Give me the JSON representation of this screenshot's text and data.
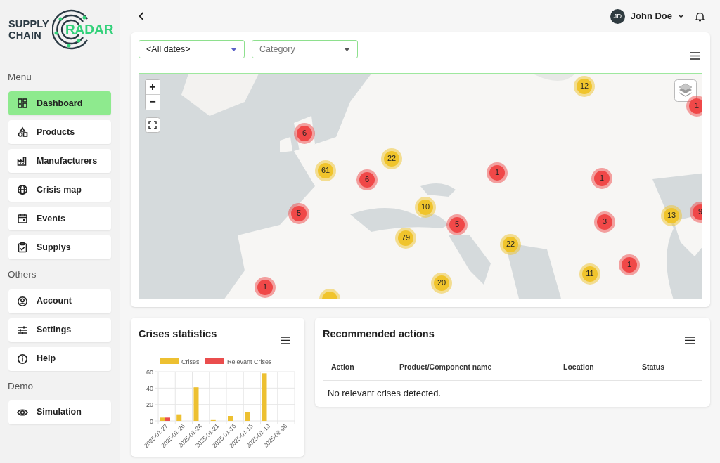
{
  "logo": {
    "line_1": "SUPPLY",
    "line_2": "CHAIN",
    "line_3": "RADAR"
  },
  "sidebar": {
    "sections": [
      {
        "title": "Menu",
        "items": [
          {
            "label": "Dashboard",
            "kind": "grid",
            "selected": true
          },
          {
            "label": "Products",
            "kind": "shapes",
            "selected": false
          },
          {
            "label": "Manufacturers",
            "kind": "factory",
            "selected": false
          },
          {
            "label": "Crisis map",
            "kind": "globe",
            "selected": false
          },
          {
            "label": "Events",
            "kind": "calendar",
            "selected": false
          },
          {
            "label": "Supplys",
            "kind": "clipboard",
            "selected": false
          }
        ]
      },
      {
        "title": "Others",
        "items": [
          {
            "label": "Account",
            "kind": "person",
            "selected": false
          },
          {
            "label": "Settings",
            "kind": "sliders",
            "selected": false
          },
          {
            "label": "Help",
            "kind": "info",
            "selected": false
          }
        ]
      },
      {
        "title": "Demo",
        "items": [
          {
            "label": "Simulation",
            "kind": "eye",
            "selected": false
          }
        ]
      }
    ]
  },
  "user": {
    "initials": "JD",
    "name": "John Doe"
  },
  "filters": [
    {
      "value": "<All dates>"
    },
    {
      "placeholder": "Category"
    }
  ],
  "map": {
    "zoom_in": "+",
    "zoom_out": "−",
    "clusters": [
      {
        "count": "12",
        "color": "#f0c42c"
      },
      {
        "count": "1",
        "color": "#f04848"
      },
      {
        "count": "6",
        "color": "#f04848"
      },
      {
        "count": "22",
        "color": "#f0c42c"
      },
      {
        "count": "61",
        "color": "#f0c42c"
      },
      {
        "count": "6",
        "color": "#f04848"
      },
      {
        "count": "1",
        "color": "#f04848"
      },
      {
        "count": "1",
        "color": "#f04848"
      },
      {
        "count": "5",
        "color": "#f04848"
      },
      {
        "count": "10",
        "color": "#f0c42c"
      },
      {
        "count": "5",
        "color": "#f04848"
      },
      {
        "count": "3",
        "color": "#f04848"
      },
      {
        "count": "13",
        "color": "#f0c42c"
      },
      {
        "count": "9",
        "color": "#f04848"
      },
      {
        "count": "79",
        "color": "#f0c42c"
      },
      {
        "count": "22",
        "color": "#f0c42c"
      },
      {
        "count": "1",
        "color": "#f04848"
      },
      {
        "count": "11",
        "color": "#f0c42c"
      },
      {
        "count": "20",
        "color": "#f0c42c"
      },
      {
        "count": "1",
        "color": "#f04848"
      },
      {
        "color": "#f0c42c"
      }
    ]
  },
  "statistics": {
    "title": "Crises statistics",
    "chart_data": {
      "type": "bar",
      "categories": [
        "2025-01-27",
        "2025-01-26",
        "2025-01-24",
        "2025-01-21",
        "2025-01-16",
        "2025-01-15",
        "2025-01-13",
        "2025-02-06"
      ],
      "series": [
        {
          "name": "Crises",
          "color": "#edc031",
          "values": [
            4,
            8,
            41,
            1,
            6,
            11,
            58,
            0
          ]
        },
        {
          "name": "Relevant Crises",
          "color": "#ea4d4d",
          "values": [
            4,
            0,
            0,
            0,
            0,
            0,
            0,
            0
          ]
        }
      ],
      "legend": "top",
      "ylim": [
        0,
        60
      ],
      "yticks": [
        0,
        20,
        40,
        60
      ]
    }
  },
  "actions": {
    "title": "Recommended actions",
    "columns": [
      "Action",
      "Product/Component name",
      "Location",
      "Status"
    ],
    "empty_message": "No relevant crises detected."
  }
}
